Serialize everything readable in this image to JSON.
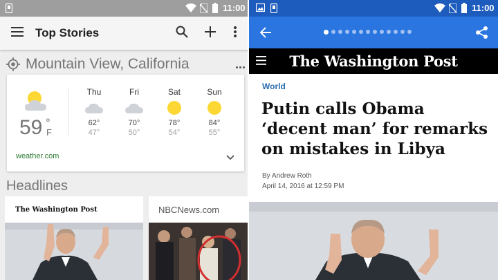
{
  "left": {
    "status_time": "11:00",
    "appbar": {
      "title": "Top Stories"
    },
    "location": {
      "name": "Mountain View, California"
    },
    "weather": {
      "current_temp": "59",
      "degree_symbol": "°",
      "unit": "F",
      "forecast": [
        {
          "day": "Thu",
          "condition": "cloudy",
          "high": "62°",
          "low": "47°"
        },
        {
          "day": "Fri",
          "condition": "cloudy",
          "high": "70°",
          "low": "50°"
        },
        {
          "day": "Sat",
          "condition": "sunny",
          "high": "78°",
          "low": "54°"
        },
        {
          "day": "Sun",
          "condition": "sunny",
          "high": "84°",
          "low": "55°"
        }
      ],
      "source": "weather.com"
    },
    "headlines": {
      "label": "Headlines",
      "cards": [
        {
          "source": "The Washington Post",
          "source_style": "masthead-logo"
        },
        {
          "source": "NBCNews.com"
        }
      ]
    }
  },
  "right": {
    "status_time": "11:00",
    "page_dots": {
      "total": 13,
      "active_index": 0
    },
    "masthead": "The Washington Post",
    "article": {
      "section": "World",
      "headline": "Putin calls Obama ‘decent man’ for remarks on mistakes in Libya",
      "byline": "By Andrew Roth",
      "date": "April 14, 2016 at 12:59 PM"
    }
  },
  "colors": {
    "left_statusbar": "#9e9e9e",
    "right_statusbar": "#1d5bbd",
    "right_appbar": "#2a75e0",
    "sun": "#fdd835",
    "link_green": "#2e7d32",
    "section_blue": "#2a6db0"
  },
  "icons": {
    "menu": "hamburger-icon",
    "search": "search-icon",
    "add": "plus-icon",
    "more": "more-vert-icon",
    "location": "gps-icon",
    "back": "arrow-back-icon",
    "share": "share-icon"
  }
}
